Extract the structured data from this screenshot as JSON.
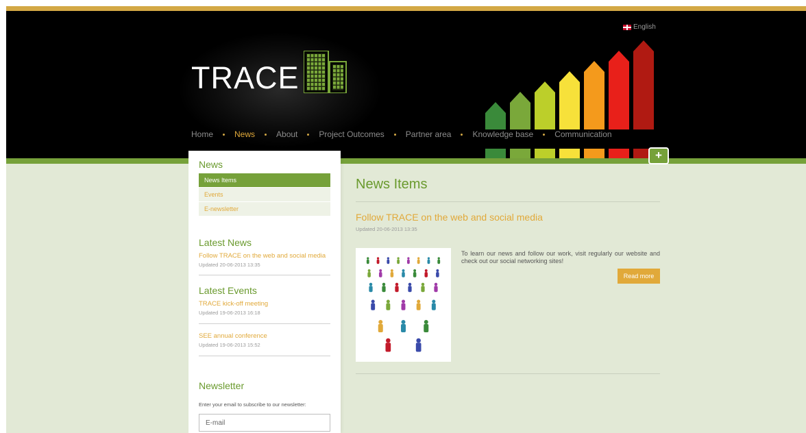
{
  "language": {
    "label": "English"
  },
  "brand": {
    "logo_text": "TRACE"
  },
  "nav": {
    "items": [
      {
        "label": "Home",
        "active": false
      },
      {
        "label": "News",
        "active": true
      },
      {
        "label": "About",
        "active": false
      },
      {
        "label": "Project Outcomes",
        "active": false
      },
      {
        "label": "Partner area",
        "active": false
      },
      {
        "label": "Knowledge base",
        "active": false
      },
      {
        "label": "Communication",
        "active": false
      }
    ]
  },
  "decoration": {
    "bar_colors": [
      "#3a8a3a",
      "#7aa83a",
      "#bccf2a",
      "#f7e13a",
      "#f49a1c",
      "#e8201a",
      "#b01a12"
    ],
    "plus_icon": "+"
  },
  "sidebar": {
    "section_title": "News",
    "menu": [
      {
        "label": "News Items",
        "active": true
      },
      {
        "label": "Events",
        "active": false
      },
      {
        "label": "E-newsletter",
        "active": false
      }
    ],
    "latest_news": {
      "title": "Latest News",
      "items": [
        {
          "title": "Follow TRACE on the web and social media",
          "date": "Updated 20-06-2013 13:35"
        }
      ]
    },
    "latest_events": {
      "title": "Latest Events",
      "items": [
        {
          "title": "TRACE kick-off meeting",
          "date": "Updated 19-06-2013 16:18"
        },
        {
          "title": "SEE annual conference",
          "date": "Updated 19-06-2013 15:52"
        }
      ]
    },
    "newsletter": {
      "title": "Newsletter",
      "text": "Enter your email to subscribe to our newsletter:",
      "placeholder": "E-mail"
    }
  },
  "main": {
    "page_title": "News Items",
    "article": {
      "title": "Follow TRACE on the web and social media",
      "date": "Updated 20-06-2013 13:35",
      "text": "To learn our news and follow our work, visit regularly our website and check out our social networking sites!",
      "read_more": "Read more"
    }
  },
  "colors": {
    "accent_gold": "#e1a93a",
    "accent_green": "#6a9a2e",
    "header_bg": "#000000",
    "page_bg": "#e2e9d6"
  }
}
